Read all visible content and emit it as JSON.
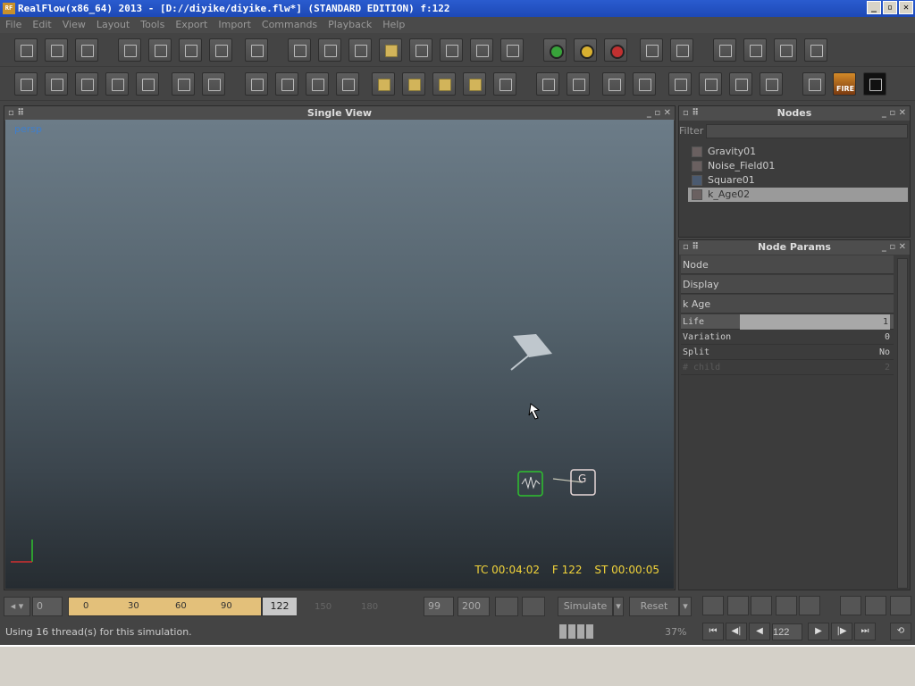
{
  "window": {
    "title": "RealFlow(x86_64) 2013 - [D://diyike/diyike.flw*] (STANDARD EDITION) f:122",
    "logo": "RF",
    "minimize": "_",
    "restore": "▫",
    "close": "✕"
  },
  "menu": [
    "File",
    "Edit",
    "View",
    "Layout",
    "Tools",
    "Export",
    "Import",
    "Commands",
    "Playback",
    "Help"
  ],
  "viewport": {
    "title": "Single View",
    "camera": "persp",
    "tc": "TC 00:04:02",
    "frame": "F 122",
    "st": "ST 00:00:05"
  },
  "nodes": {
    "title": "Nodes",
    "filter_label": "Filter",
    "filter_value": "",
    "items": [
      "Gravity01",
      "Noise_Field01",
      "Square01",
      "k_Age02"
    ]
  },
  "params": {
    "title": "Node Params",
    "sections": [
      "Node",
      "Display",
      "k Age"
    ],
    "rows": [
      {
        "key": "Life",
        "value": "1"
      },
      {
        "key": "Variation",
        "value": "0"
      },
      {
        "key": "Split",
        "value": "No"
      },
      {
        "key": "# child",
        "value": "2"
      }
    ]
  },
  "timeline": {
    "start": "0",
    "ticks": [
      "0",
      "30",
      "60",
      "90"
    ],
    "current": "122",
    "after": [
      "150",
      "180"
    ],
    "end_a": "99",
    "end_b": "200"
  },
  "buttons": {
    "simulate": "Simulate",
    "reset": "Reset"
  },
  "status": "Using 16 thread(s) for this simulation.",
  "progress": "37%",
  "playback": {
    "frame": "122"
  },
  "toolbar_icons": [
    "new-icon",
    "open-icon",
    "save-icon",
    "select-icon",
    "move-icon",
    "rotate-icon",
    "scale-icon",
    "axis-icon",
    "plane-icon",
    "particles-icon",
    "split-icon",
    "cube-icon",
    "sphere-icon",
    "camera-icon",
    "wave-icon",
    "crate-icon",
    "green-light-icon",
    "yellow-light-icon",
    "red-light-icon",
    "save-green-icon",
    "save-red-icon"
  ],
  "colors": {
    "hud": "#f2d43a",
    "persp": "#3f7fcc",
    "timeline": "#e3c07a",
    "titlebar": "#1d49b6"
  }
}
